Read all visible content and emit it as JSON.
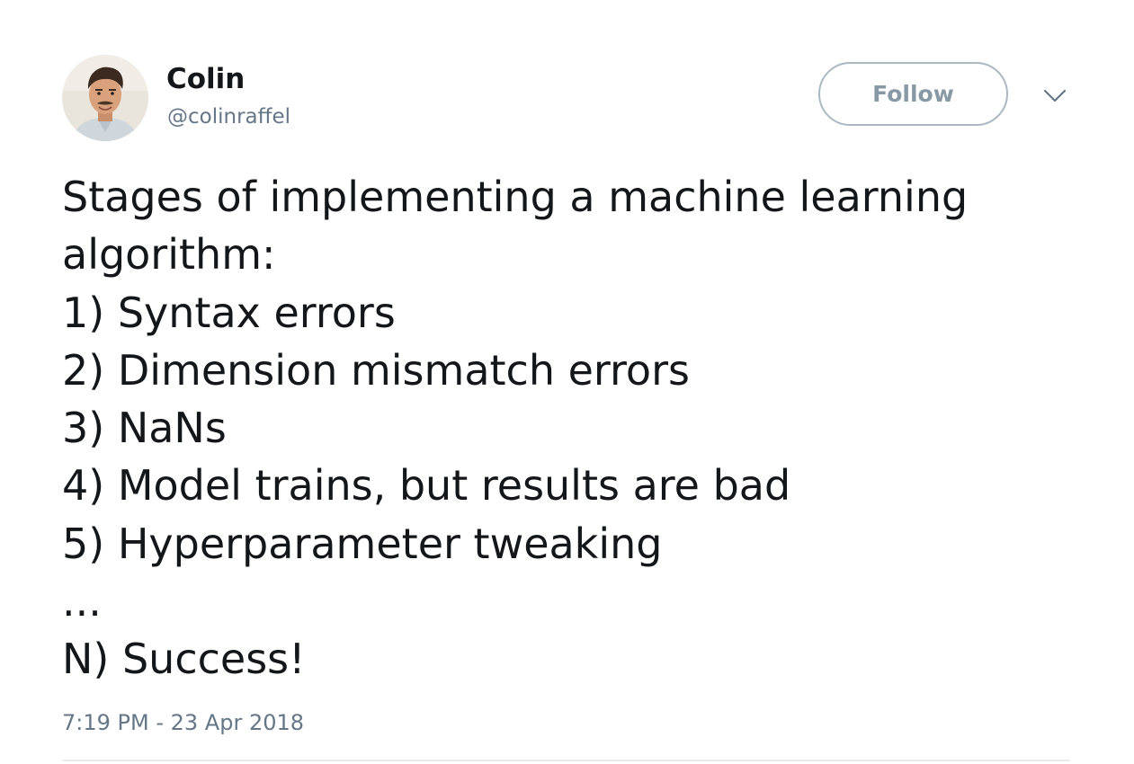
{
  "tweet": {
    "author": {
      "display_name": "Colin",
      "handle": "@colinraffel",
      "avatar_icon": "profile-photo"
    },
    "follow_label": "Follow",
    "menu_icon": "chevron-down-icon",
    "text_lines": [
      "Stages of implementing a machine learning",
      "algorithm:",
      "1) Syntax errors",
      "2) Dimension mismatch errors",
      "3) NaNs",
      "4) Model trains, but results are bad",
      "5) Hyperparameter tweaking",
      "...",
      "N) Success!"
    ],
    "timestamp": "7:19 PM - 23 Apr 2018"
  },
  "colors": {
    "text": "#14171a",
    "secondary_text": "#657786",
    "follow_border": "#aab8c2",
    "follow_text": "#8899a6",
    "divider": "#e6ecf0"
  }
}
